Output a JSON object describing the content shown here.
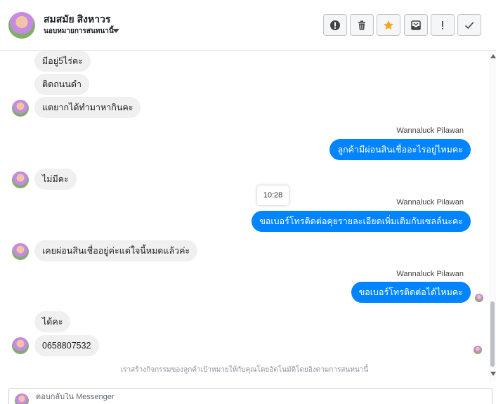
{
  "header": {
    "contact_name": "สมสมัย สิงหาวร",
    "conversation_status": "นอบหมายการสนทนานี้",
    "actions": [
      {
        "icon": "alert-icon",
        "label": "!"
      },
      {
        "icon": "trash-icon",
        "label": ""
      },
      {
        "icon": "star-icon",
        "label": ""
      },
      {
        "icon": "archive-icon",
        "label": ""
      },
      {
        "icon": "exclamation-icon",
        "label": "!"
      },
      {
        "icon": "check-icon",
        "label": ""
      }
    ],
    "star_color": "#f5a623"
  },
  "thread": {
    "messages": [
      {
        "direction": "in",
        "text": "มีอยู่5ไร่คะ"
      },
      {
        "direction": "in",
        "text": "ติดถนนดำ"
      },
      {
        "direction": "in",
        "text": "แตยากได้ทำมาหากินคะ"
      },
      {
        "direction": "out",
        "sender": "Wannaluck Pilawan",
        "text": "ลูกค้ามีผ่อนสินเชื่ออะไรอยู่ไหมคะ"
      },
      {
        "direction": "in",
        "text": "ไม่มีคะ"
      },
      {
        "direction": "out",
        "sender": "Wannaluck Pilawan",
        "text": "ขอเบอร์โทรติดต่อคุยรายละเอียดเพิ่มเติมกับเซลล์นะคะ"
      },
      {
        "direction": "in",
        "text": "เคยผ่อนสินเชื่ออยู่ค่ะแต่ใจนี้หมดแล้วค่ะ"
      },
      {
        "direction": "out",
        "sender": "Wannaluck Pilawan",
        "text": "ขอเบอร์โทรติดต่อได้ไหมคะ"
      },
      {
        "direction": "in",
        "text": "ได้คะ"
      },
      {
        "direction": "in",
        "text": "0658807532"
      }
    ],
    "timestamp_tooltip": "10:28",
    "footer_note": "เราสร้างกิจกรรมของลูกค้าเป้าหมายให้กับคุณโดยอัตโนมัติโดยอิงตามการสนทนานี้",
    "outgoing_color": "#0084ff",
    "incoming_color": "#f1f0f0"
  },
  "composer": {
    "placeholder": "ตอบกลับใน Messenger"
  }
}
